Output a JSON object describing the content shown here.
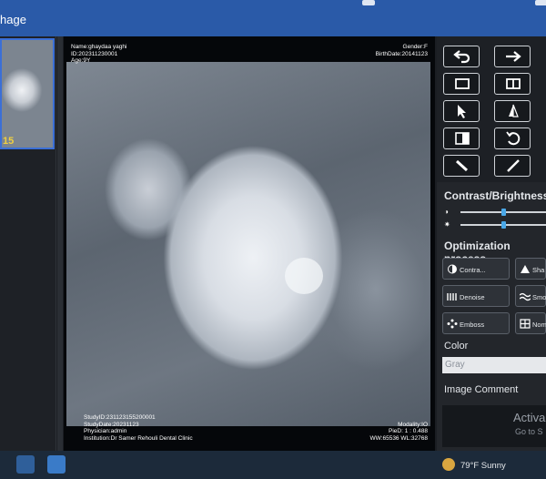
{
  "window": {
    "title": "hage"
  },
  "thumbnail": {
    "label": "15"
  },
  "overlay": {
    "name": "Name:ghaydaa yaghi",
    "id": "ID:202311230001",
    "age": "Age:9Y",
    "gender": "Gender:F",
    "birthdate": "BirthDate:20141123",
    "study_id": "StudyID:231123155200001",
    "study_date": "StudyDate:20231123",
    "physician": "Physician:admin",
    "institution": "Institution:Dr Samer Rehouli Dental Clinic",
    "modality": "Modality:IO",
    "pixel": "PieD: 1 : 0.488",
    "window_level": "WW:65536   WL:32768"
  },
  "panel": {
    "contrast_title": "Contrast/Brightness",
    "contrast_value": 0.5,
    "brightness_value": 0.5,
    "optimization_title": "Optimization process",
    "buttons": {
      "contrast": "Contra...",
      "sharpen": "Sha",
      "denoise": "Denoise",
      "smooth": "Smo",
      "emboss": "Emboss",
      "normal": "Nom"
    },
    "color_title": "Color",
    "color_value": "Gray",
    "comment_title": "Image Comment",
    "watermark1": "Activa",
    "watermark2": "Go to S"
  },
  "taskbar": {
    "weather": "79°F  Sunny"
  },
  "colors": {
    "accent": "#3b6fd6",
    "slider": "#4aa8e8",
    "titlebar": "#2a5aa8"
  }
}
